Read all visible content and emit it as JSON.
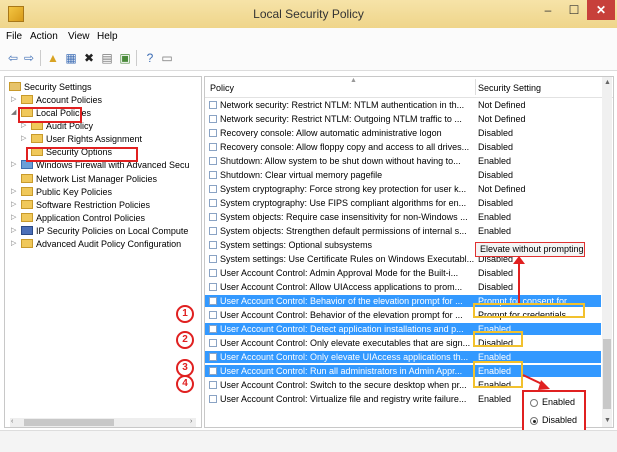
{
  "window": {
    "title": "Local Security Policy",
    "min": "–",
    "max": "☐",
    "close": "✕"
  },
  "menu": [
    "File",
    "Action",
    "View",
    "Help"
  ],
  "toolbar": [
    "back-icon",
    "forward-icon",
    "folder-up-icon",
    "show-hide-tree-icon",
    "delete-icon",
    "properties-icon",
    "export-list-icon",
    "help-icon",
    "console-icon"
  ],
  "tree": {
    "root": "Security Settings",
    "account_policies": "Account Policies",
    "local_policies": "Local Policies",
    "audit_policy": "Audit Policy",
    "user_rights": "User Rights Assignment",
    "security_options": "Security Options",
    "firewall": "Windows Firewall with Advanced Secu",
    "network_list": "Network List Manager Policies",
    "public_key": "Public Key Policies",
    "software_restriction": "Software Restriction Policies",
    "app_control": "Application Control Policies",
    "ipsec": "IP Security Policies on Local Compute",
    "audit_config": "Advanced Audit Policy Configuration"
  },
  "list": {
    "col_policy": "Policy",
    "col_setting": "Security Setting",
    "rows": [
      {
        "policy": "Network security: Restrict NTLM: NTLM authentication in th...",
        "setting": "Not Defined"
      },
      {
        "policy": "Network security: Restrict NTLM: Outgoing NTLM traffic to ...",
        "setting": "Not Defined"
      },
      {
        "policy": "Recovery console: Allow automatic administrative logon",
        "setting": "Disabled"
      },
      {
        "policy": "Recovery console: Allow floppy copy and access to all drives...",
        "setting": "Disabled"
      },
      {
        "policy": "Shutdown: Allow system to be shut down without having to...",
        "setting": "Enabled"
      },
      {
        "policy": "Shutdown: Clear virtual memory pagefile",
        "setting": "Disabled"
      },
      {
        "policy": "System cryptography: Force strong key protection for user k...",
        "setting": "Not Defined"
      },
      {
        "policy": "System cryptography: Use FIPS compliant algorithms for en...",
        "setting": "Disabled"
      },
      {
        "policy": "System objects: Require case insensitivity for non-Windows ...",
        "setting": "Enabled"
      },
      {
        "policy": "System objects: Strengthen default permissions of internal s...",
        "setting": "Enabled"
      },
      {
        "policy": "System settings: Optional subsystems",
        "setting": ""
      },
      {
        "policy": "System settings: Use Certificate Rules on Windows Executabl...",
        "setting": "Disabled"
      },
      {
        "policy": "User Account Control: Admin Approval Mode for the Built-i...",
        "setting": "Disabled"
      },
      {
        "policy": "User Account Control: Allow UIAccess applications to prom...",
        "setting": "Disabled"
      },
      {
        "policy": "User Account Control: Behavior of the elevation prompt for ...",
        "setting": "Prompt for consent for ..."
      },
      {
        "policy": "User Account Control: Behavior of the elevation prompt for ...",
        "setting": "Prompt for credentials"
      },
      {
        "policy": "User Account Control: Detect application installations and p...",
        "setting": "Enabled"
      },
      {
        "policy": "User Account Control: Only elevate executables that are sign...",
        "setting": "Disabled"
      },
      {
        "policy": "User Account Control: Only elevate UIAccess applications th...",
        "setting": "Enabled"
      },
      {
        "policy": "User Account Control: Run all administrators in Admin Appr...",
        "setting": "Enabled"
      },
      {
        "policy": "User Account Control: Switch to the secure desktop when pr...",
        "setting": "Enabled"
      },
      {
        "policy": "User Account Control: Virtualize file and registry write failure...",
        "setting": "Enabled"
      }
    ]
  },
  "annotations": {
    "popup": "Elevate without prompting",
    "n1": "1",
    "n2": "2",
    "n3": "3",
    "n4": "4",
    "opt_enabled": "Enabled",
    "opt_disabled": "Disabled"
  },
  "colors": {
    "title_bar": "#f3dd9a",
    "selection": "#3399ff",
    "annotation_red": "#e02020",
    "annotation_yellow": "#f2c12e"
  }
}
